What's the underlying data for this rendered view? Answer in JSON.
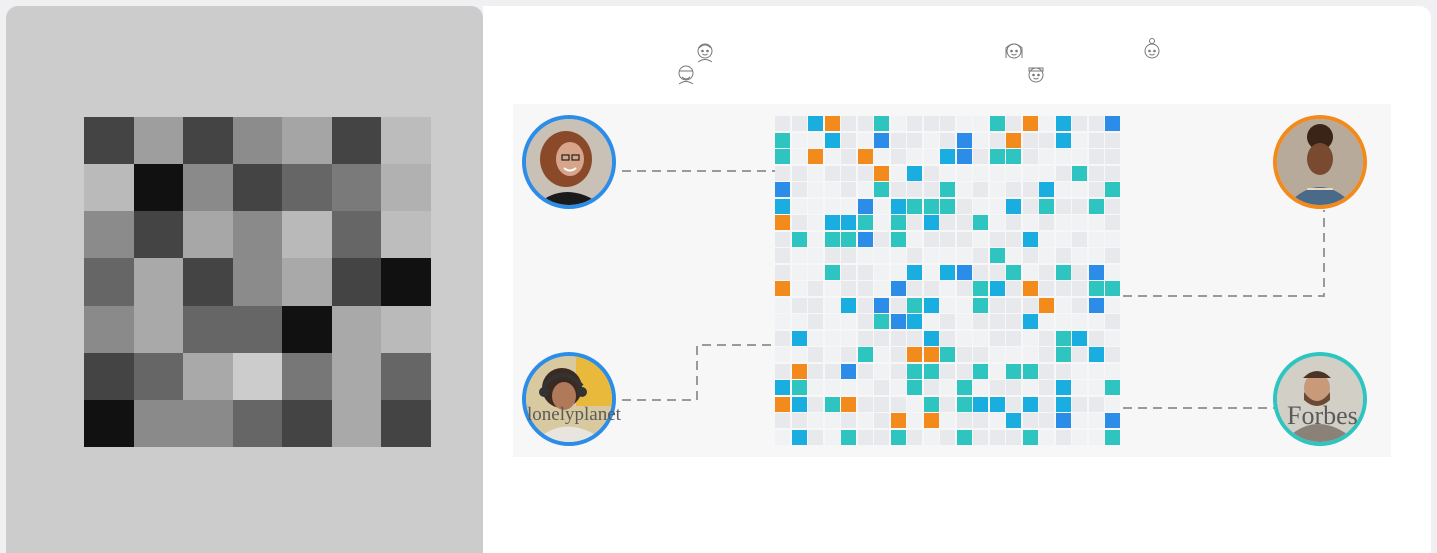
{
  "placeholder_image": {
    "icon": "image-placeholder-icon",
    "grid": [
      [
        "#444444",
        "#9e9e9e",
        "#444444",
        "#8c8c8c",
        "#a5a5a5",
        "#444444",
        "#bcbcbc"
      ],
      [
        "#bababa",
        "#111111",
        "#8a8a8a",
        "#444444",
        "#666666",
        "#7a7a7a",
        "#b1b1b1"
      ],
      [
        "#8b8b8b",
        "#444444",
        "#a7a7a7",
        "#8a8a8a",
        "#b9b9b9",
        "#666666",
        "#bdbdbd"
      ],
      [
        "#666666",
        "#a9a9a9",
        "#444444",
        "#8b8b8b",
        "#a9a9a9",
        "#444444",
        "#111111"
      ],
      [
        "#8a8a8a",
        "#a9a9a9",
        "#666666",
        "#666666",
        "#111111",
        "#a9a9a9",
        "#bababa"
      ],
      [
        "#444444",
        "#666666",
        "#a9a9a9",
        "#cccccc",
        "#777777",
        "#a9a9a9",
        "#666666"
      ],
      [
        "#111111",
        "#8a8a8a",
        "#8a8a8a",
        "#666666",
        "#444444",
        "#a9a9a9",
        "#444444"
      ]
    ]
  },
  "top_icons": [
    "user-face-icon",
    "user-face-icon",
    "user-face-icon",
    "user-face-icon",
    "user-face-icon"
  ],
  "colors": {
    "blue": "#2b8de8",
    "teal": "#2ec4c0",
    "cyan": "#1aaee0",
    "orange": "#f28a1c",
    "light": "#e8e9ec",
    "connector": "#9a9a9a"
  },
  "avatars": [
    {
      "name": "avatar-woman-glasses",
      "ring": "#2b8de8"
    },
    {
      "name": "avatar-man-headphones",
      "ring": "#2b8de8"
    },
    {
      "name": "avatar-woman-curly-hair",
      "ring": "#f28a1c"
    },
    {
      "name": "avatar-man-beard",
      "ring": "#2ec4c0"
    }
  ],
  "logos": {
    "lonely_planet": "lonelyplanet",
    "forbes": "Forbes"
  }
}
